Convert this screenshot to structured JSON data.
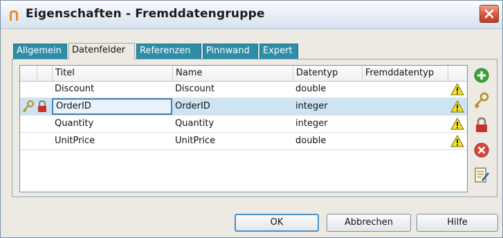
{
  "window": {
    "title": "Eigenschaften - Fremddatengruppe"
  },
  "tabs": [
    {
      "label": "Allgemein",
      "active": false
    },
    {
      "label": "Datenfelder",
      "active": true
    },
    {
      "label": "Referenzen",
      "active": false
    },
    {
      "label": "Pinnwand",
      "active": false
    },
    {
      "label": "Expert",
      "active": false
    }
  ],
  "grid": {
    "columns": [
      "Titel",
      "Name",
      "Datentyp",
      "Fremddatentyp"
    ],
    "rows": [
      {
        "titel": "Discount",
        "name": "Discount",
        "datentyp": "double",
        "fremddatentyp": "",
        "warning": true,
        "key_icon": false,
        "lock_icon": false,
        "selected": false
      },
      {
        "titel": "OrderID",
        "name": "OrderID",
        "datentyp": "integer",
        "fremddatentyp": "",
        "warning": true,
        "key_icon": true,
        "lock_icon": true,
        "selected": true
      },
      {
        "titel": "Quantity",
        "name": "Quantity",
        "datentyp": "integer",
        "fremddatentyp": "",
        "warning": true,
        "key_icon": false,
        "lock_icon": false,
        "selected": false
      },
      {
        "titel": "UnitPrice",
        "name": "UnitPrice",
        "datentyp": "double",
        "fremddatentyp": "",
        "warning": true,
        "key_icon": false,
        "lock_icon": false,
        "selected": false
      }
    ]
  },
  "side_buttons": [
    "add-icon",
    "key-icon",
    "lock-icon",
    "delete-icon",
    "edit-note-icon"
  ],
  "buttons": {
    "ok": "OK",
    "cancel": "Abbrechen",
    "help": "Hilfe"
  },
  "colors": {
    "tab_bg": "#2e8da8",
    "selection": "#cfe4f3",
    "close_red": "#d9553a",
    "warning_yellow": "#f5e12a"
  }
}
